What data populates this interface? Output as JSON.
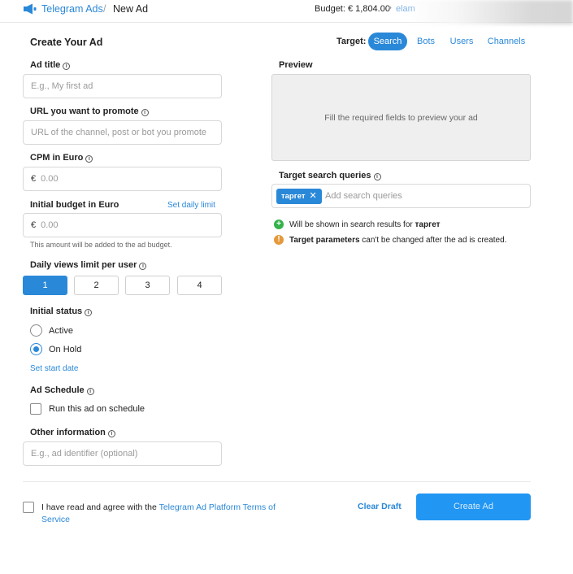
{
  "header": {
    "brand": "Telegram Ads",
    "separator": "/",
    "crumb": "New Ad",
    "budget": "Budget: € 1,804.00",
    "dot": "•",
    "user": "elam"
  },
  "page": {
    "title": "Create Your Ad"
  },
  "target": {
    "label": "Target:",
    "tabs": [
      {
        "label": "Search",
        "active": true
      },
      {
        "label": "Bots",
        "active": false
      },
      {
        "label": "Users",
        "active": false
      },
      {
        "label": "Channels",
        "active": false
      }
    ]
  },
  "form": {
    "ad_title": {
      "label": "Ad title",
      "placeholder": "E.g., My first ad"
    },
    "url": {
      "label": "URL you want to promote",
      "placeholder": "URL of the channel, post or bot you promote"
    },
    "cpm": {
      "label": "CPM in Euro",
      "currency": "€",
      "placeholder": "0.00"
    },
    "budget": {
      "label": "Initial budget in Euro",
      "daily_link": "Set daily limit",
      "currency": "€",
      "placeholder": "0.00",
      "hint": "This amount will be added to the ad budget."
    },
    "views": {
      "label": "Daily views limit per user",
      "options": [
        "1",
        "2",
        "3",
        "4"
      ],
      "selected": "1"
    },
    "status": {
      "label": "Initial status",
      "options": [
        "Active",
        "On Hold"
      ],
      "selected": "On Hold",
      "start_link": "Set start date"
    },
    "schedule": {
      "label": "Ad Schedule",
      "checkbox_label": "Run this ad on schedule"
    },
    "other": {
      "label": "Other information",
      "placeholder": "E.g., ad identifier (optional)"
    }
  },
  "preview": {
    "label": "Preview",
    "empty_text": "Fill the required fields to preview your ad"
  },
  "queries": {
    "label": "Target search queries",
    "chip": "таргет",
    "chip_remove": "✕",
    "placeholder": "Add search queries",
    "notes": [
      {
        "prefix": "Will be shown in search results for ",
        "strong": "таргет",
        "icon": "plus-icon",
        "color": "#34b34a"
      },
      {
        "prefix": "",
        "strong": "Target parameters",
        "suffix": " can't be changed after the ad is created.",
        "icon": "exclamation-icon",
        "color": "#e5993a"
      }
    ]
  },
  "footer": {
    "terms_prefix": "I have read and agree with the ",
    "terms_link": "Telegram Ad Platform Terms of Service",
    "clear": "Clear Draft",
    "create": "Create Ad"
  },
  "colors": {
    "accent": "#2a88d8",
    "button": "#2196f3"
  }
}
